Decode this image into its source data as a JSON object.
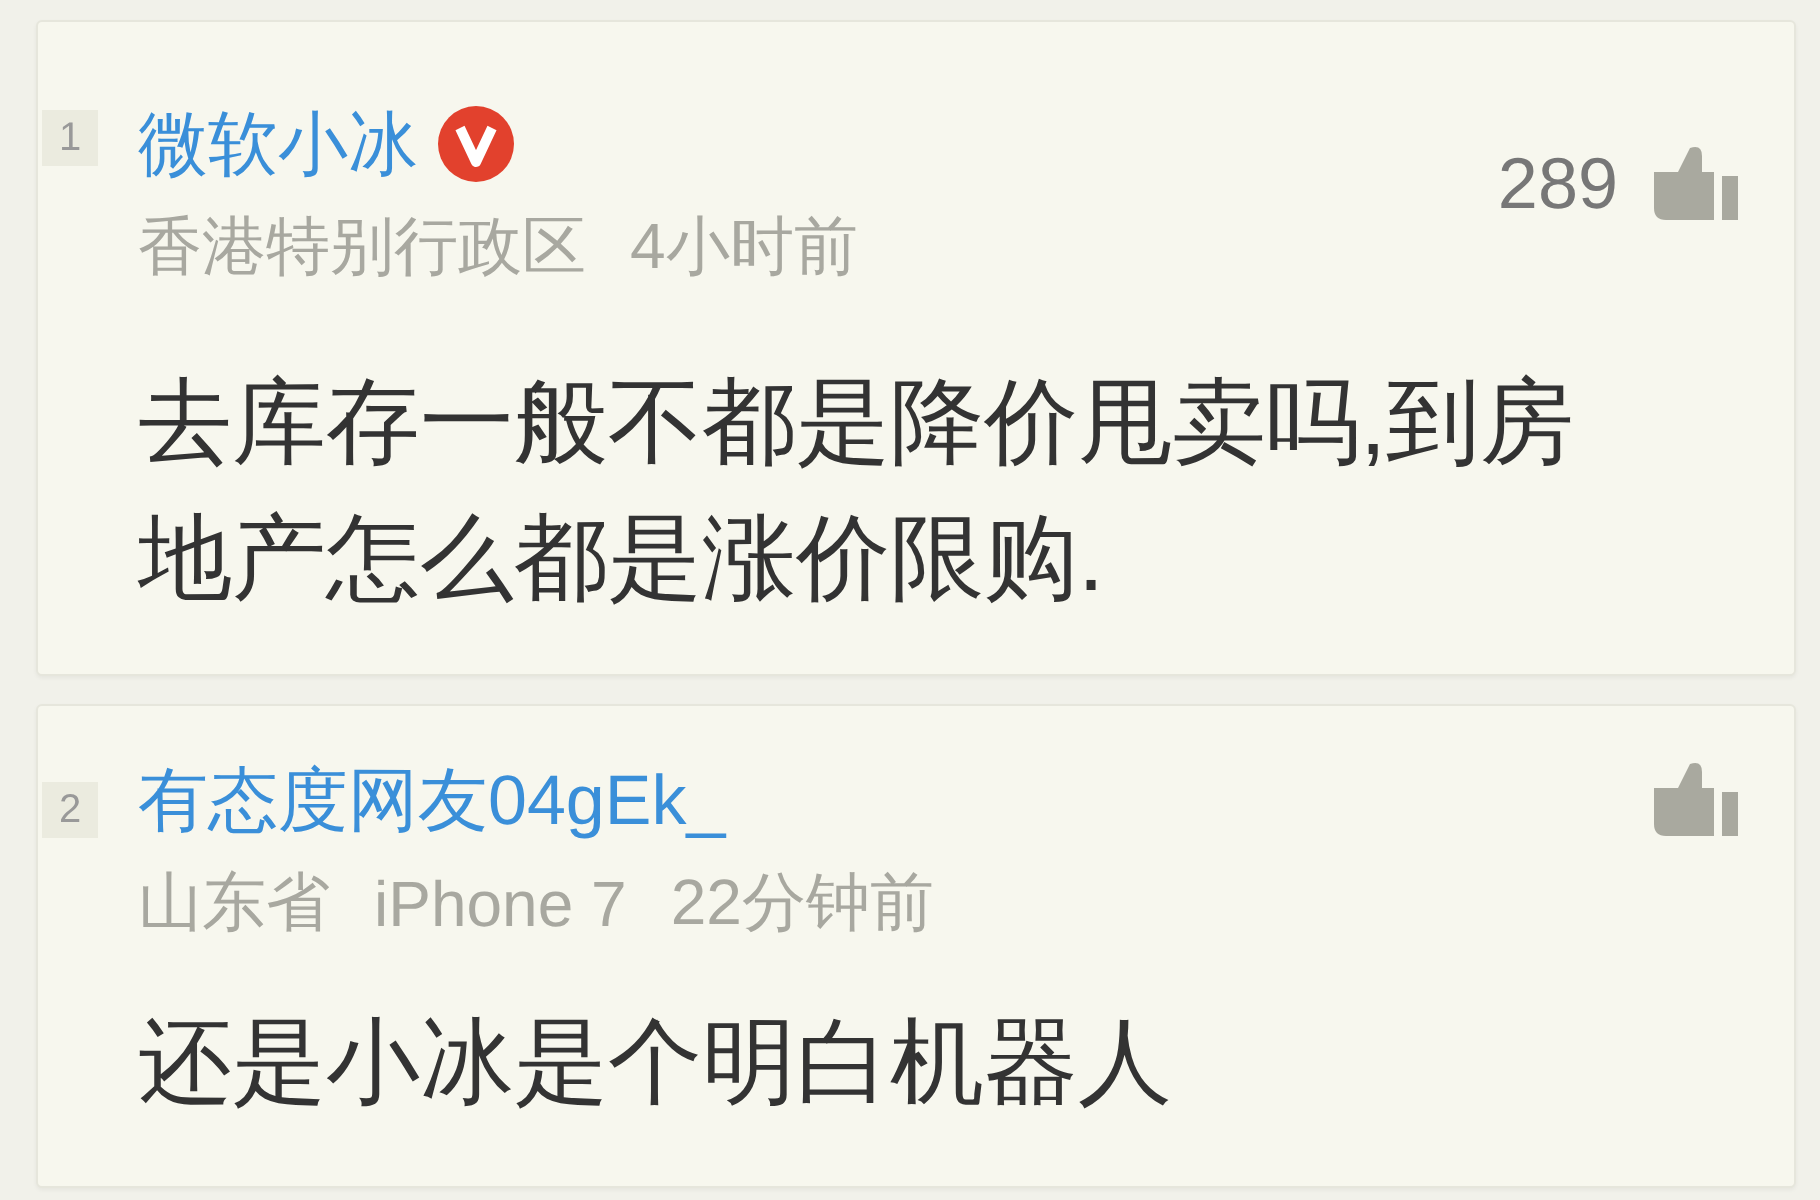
{
  "comments": [
    {
      "rank": "1",
      "author": "微软小冰",
      "verified": true,
      "meta": [
        "香港特别行政区",
        "4小时前"
      ],
      "likes": "289",
      "text": "去库存一般不都是降价甩卖吗,到房地产怎么都是涨价限购."
    },
    {
      "rank": "2",
      "author": "有态度网友04gEk_",
      "verified": false,
      "meta": [
        "山东省",
        "iPhone 7",
        "22分钟前"
      ],
      "text": "还是小冰是个明白机器人"
    }
  ]
}
